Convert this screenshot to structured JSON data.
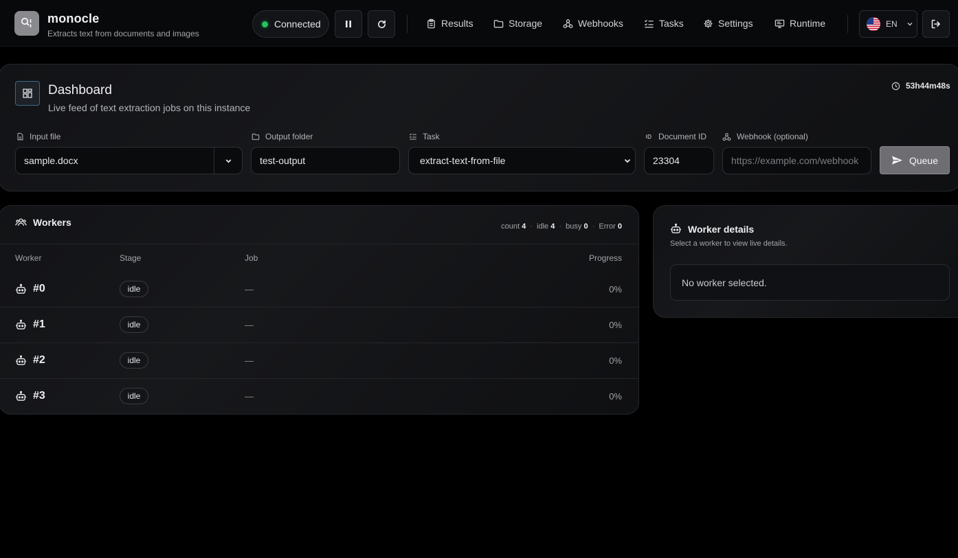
{
  "app": {
    "name": "monocle",
    "subtitle": "Extracts text from documents and images"
  },
  "status": {
    "label": "Connected",
    "color": "#22c55e"
  },
  "controls": {
    "pause_icon": "pause-icon",
    "refresh_icon": "refresh-icon"
  },
  "nav": [
    {
      "label": "Results",
      "icon": "clipboard-icon"
    },
    {
      "label": "Storage",
      "icon": "folder-icon"
    },
    {
      "label": "Webhooks",
      "icon": "webhook-icon"
    },
    {
      "label": "Tasks",
      "icon": "list-check-icon"
    },
    {
      "label": "Settings",
      "icon": "gear-icon"
    },
    {
      "label": "Runtime",
      "icon": "monitor-icon"
    }
  ],
  "language": {
    "code": "EN",
    "flag": "us-flag-icon"
  },
  "dashboard": {
    "title": "Dashboard",
    "subtitle": "Live feed of text extraction jobs on this instance",
    "uptime": "53h44m48s"
  },
  "form": {
    "input_file": {
      "label": "Input file",
      "value": "sample.docx"
    },
    "output_folder": {
      "label": "Output folder",
      "value": "test-output"
    },
    "task": {
      "label": "Task",
      "value": "extract-text-from-file"
    },
    "document_id": {
      "label": "Document ID",
      "value": "23304"
    },
    "webhook": {
      "label": "Webhook (optional)",
      "placeholder": "https://example.com/webhook"
    },
    "queue_label": "Queue"
  },
  "workers": {
    "title": "Workers",
    "stats": {
      "count_label": "count",
      "count": "4",
      "idle_label": "idle",
      "idle": "4",
      "busy_label": "busy",
      "busy": "0",
      "error_label": "Error",
      "error": "0"
    },
    "columns": {
      "worker": "Worker",
      "stage": "Stage",
      "job": "Job",
      "progress": "Progress"
    },
    "rows": [
      {
        "name": "#0",
        "stage": "idle",
        "job": "—",
        "progress": "0%"
      },
      {
        "name": "#1",
        "stage": "idle",
        "job": "—",
        "progress": "0%"
      },
      {
        "name": "#2",
        "stage": "idle",
        "job": "—",
        "progress": "0%"
      },
      {
        "name": "#3",
        "stage": "idle",
        "job": "—",
        "progress": "0%"
      }
    ]
  },
  "worker_details": {
    "title": "Worker details",
    "subtitle": "Select a worker to view live details.",
    "empty_message": "No worker selected."
  }
}
